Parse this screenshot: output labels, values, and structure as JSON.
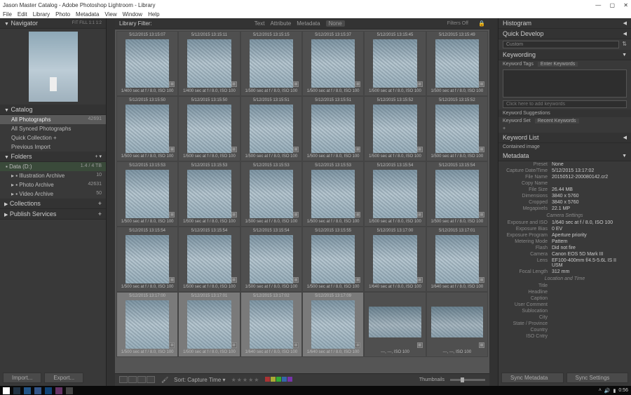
{
  "window": {
    "title": "Jason Master Catalog - Adobe Photoshop Lightroom - Library"
  },
  "menu": [
    "File",
    "Edit",
    "Library",
    "Photo",
    "Metadata",
    "View",
    "Window",
    "Help"
  ],
  "nav": {
    "title": "Navigator",
    "modes": "FIT   FILL   1:1   1:2"
  },
  "catalog": {
    "title": "Catalog",
    "items": [
      {
        "label": "All Photographs",
        "count": "42691",
        "sel": true
      },
      {
        "label": "All Synced Photographs",
        "count": ""
      },
      {
        "label": "Quick Collection +",
        "count": ""
      },
      {
        "label": "Previous Import",
        "count": ""
      }
    ]
  },
  "folders": {
    "title": "Folders",
    "vol": "Data (D:)",
    "volmeta": "1.4 / 4 TB",
    "items": [
      {
        "label": "Illustration Archive",
        "count": "10"
      },
      {
        "label": "Photo Archive",
        "count": "42631"
      },
      {
        "label": "Video Archive",
        "count": "50"
      }
    ]
  },
  "collections": {
    "title": "Collections"
  },
  "publish": {
    "title": "Publish Services"
  },
  "importBtn": "Import...",
  "exportBtn": "Export...",
  "filter": {
    "label": "Library Filter:",
    "tabs": [
      "Text",
      "Attribute",
      "Metadata",
      "None"
    ],
    "status": "Filters Off"
  },
  "thumbs": {
    "dates": [
      "5/12/2015 13:15:07",
      "5/12/2015 13:15:11",
      "5/12/2015 13:15:15",
      "5/12/2015 13:15:37",
      "5/12/2015 13:15:45",
      "5/12/2015 13:15:49",
      "5/12/2015 13:15:50",
      "5/12/2015 13:15:50",
      "5/12/2015 13:15:51",
      "5/12/2015 13:15:51",
      "5/12/2015 13:15:52",
      "5/12/2015 13:15:52",
      "5/12/2015 13:15:53",
      "5/12/2015 13:15:53",
      "5/12/2015 13:15:53",
      "5/12/2015 13:15:53",
      "5/12/2015 13:15:54",
      "5/12/2015 13:15:54",
      "5/12/2015 13:15:54",
      "5/12/2015 13:15:54",
      "5/12/2015 13:15:54",
      "5/12/2015 13:15:55",
      "5/12/2015 13:17:00",
      "5/12/2015 13:17:01"
    ],
    "exp_a": "1/400 sec at f / 8.0, ISO 100",
    "exp_b": "1/500 sec at f / 8.0, ISO 100",
    "exp_c": "1/640 sec at f / 8.0, ISO 100",
    "exp_p": "---, ---, ISO 100",
    "sel_date": "5/12/2015 13:17:02",
    "r1d": "5/12/2015 13:17:00",
    "r2d": "5/12/2015 13:17:01",
    "r3d": "5/12/2015 13:17:02",
    "r4d": "5/12/2015 13:17:09"
  },
  "toolbar": {
    "sortLabel": "Sort:",
    "sortField": "Capture Time",
    "thumbLabel": "Thumbnails"
  },
  "right": {
    "histogram": "Histogram",
    "quickdev": "Quick Develop",
    "custom": "Custom",
    "keywording": "Keywording",
    "kwTags": "Keyword Tags",
    "kwMode": "Enter Keywords",
    "kwAdd": "Click here to add keywords",
    "kwSug": "Keyword Suggestions",
    "kwSet": "Keyword Set",
    "kwRecent": "Recent Keywords",
    "kwList": "Keyword List",
    "kwContain": "Contained image",
    "metadata": "Metadata",
    "preset": "Preset",
    "presetV": "None",
    "cameraSettings": "Camera Settings",
    "locTime": "Location and Time",
    "fields": [
      {
        "k": "Capture Date/Time",
        "v": "5/12/2015 13:17:02"
      },
      {
        "k": "File Name",
        "v": "20150512-200080142.cr2"
      },
      {
        "k": "Copy Name",
        "v": ""
      },
      {
        "k": "File Size",
        "v": "26.44 MB"
      },
      {
        "k": "Dimensions",
        "v": "3840 x 5760"
      },
      {
        "k": "Cropped",
        "v": "3840 x 5760"
      },
      {
        "k": "Megapixels",
        "v": "22.1 MP"
      }
    ],
    "fields2": [
      {
        "k": "Exposure and ISO",
        "v": "1/640 sec at f / 8.0, ISO 100"
      },
      {
        "k": "Exposure Bias",
        "v": "0 EV"
      },
      {
        "k": "Exposure Program",
        "v": "Aperture priority"
      },
      {
        "k": "Metering Mode",
        "v": "Pattern"
      },
      {
        "k": "Flash",
        "v": "Did not fire"
      },
      {
        "k": "Camera",
        "v": "Canon EOS 5D Mark III"
      },
      {
        "k": "Lens",
        "v": "EF100-400mm f/4.5-5.6L IS II USM"
      },
      {
        "k": "Focal Length",
        "v": "312 mm"
      }
    ],
    "fields3": [
      {
        "k": "Title",
        "v": ""
      },
      {
        "k": "Headline",
        "v": ""
      },
      {
        "k": "Caption",
        "v": ""
      },
      {
        "k": "User Comment",
        "v": ""
      },
      {
        "k": "Sublocation",
        "v": ""
      },
      {
        "k": "City",
        "v": ""
      },
      {
        "k": "State / Province",
        "v": ""
      },
      {
        "k": "Country",
        "v": ""
      },
      {
        "k": "ISO Cntry",
        "v": ""
      }
    ],
    "syncMeta": "Sync Metadata",
    "syncSettings": "Sync Settings"
  },
  "taskbar": {
    "time": "0:56"
  }
}
